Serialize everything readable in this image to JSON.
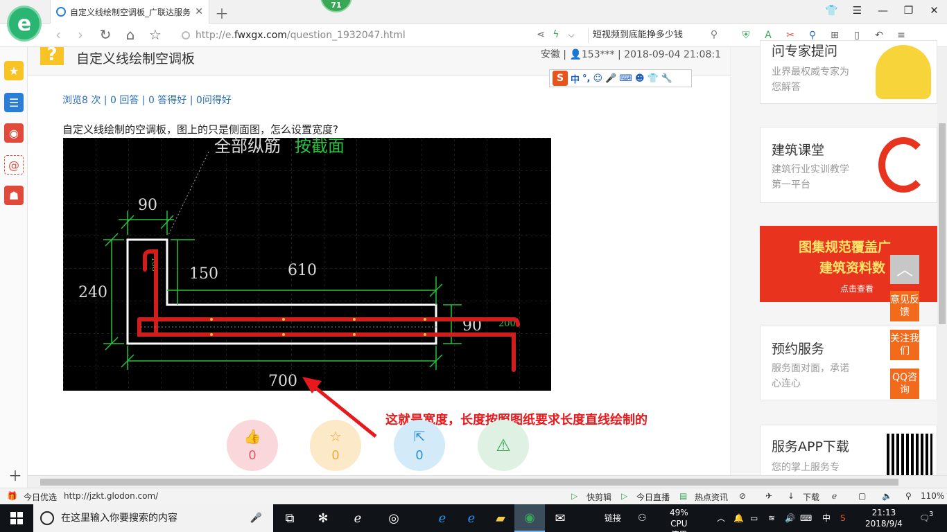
{
  "browser": {
    "tab_title": "自定义线绘制空调板_广联达服务",
    "badge_count": "71",
    "url_proto": "http://e.",
    "url_host": "fwxgx.com",
    "url_path": "/question_1932047.html",
    "search_text": "短视频到底能挣多少钱"
  },
  "question": {
    "title": "自定义线绘制空调板",
    "meta": "安徽 | 👤153*** | 2018-09-04 21:08:1",
    "stats": "浏览8 次 | 0 回答 | 0 答得好 | 0问得好",
    "body": "自定义线绘制的空调板，图上的只是侧面图，怎么设置宽度?",
    "annotation": "这就是宽度，长度按照图纸要求长度直线绘制的",
    "actions": [
      {
        "name": "like",
        "count": "0",
        "color": "#f9d7da",
        "fg": "#e05a6a"
      },
      {
        "name": "favorite",
        "count": "0",
        "color": "#fbe9c7",
        "fg": "#f2a93b"
      },
      {
        "name": "share",
        "count": "0",
        "color": "#d3eaf8",
        "fg": "#2f8fd6"
      },
      {
        "name": "report",
        "count": "",
        "color": "#dff1e2",
        "fg": "#3aa757"
      }
    ]
  },
  "ime": {
    "logo": "S",
    "mode": "中",
    "punct": "°,"
  },
  "cad": {
    "label_top": "全部纵筋",
    "label_top_green": "按截面",
    "dims": {
      "d90a": "90",
      "d240": "240",
      "d150": "150",
      "d610": "610",
      "d90b": "90",
      "d200": "200",
      "d700": "700",
      "d100": "100"
    }
  },
  "right": {
    "card1": {
      "title": "问专家提问",
      "desc": "业界最权威专家为您解答"
    },
    "card2": {
      "title": "建筑课堂",
      "desc": "建筑行业实训教学第一平台"
    },
    "banner": {
      "line1": "图集规范覆盖广",
      "line2": "建筑资料数",
      "line3": "点击查看"
    },
    "card3": {
      "title": "预约服务",
      "desc": "服务面对面，承诺心连心"
    },
    "card4": {
      "title": "服务APP下载",
      "desc": "您的掌上服务专"
    },
    "float": {
      "feedback": "意见反馈",
      "follow": "关注我们",
      "qq": "QQ咨询"
    }
  },
  "statusbar": {
    "left_label": "今日优选",
    "left_url": "http://jzkt.glodon.com/",
    "quick_cut": "快剪辑",
    "live": "今日直播",
    "news": "热点资讯",
    "download": "下载",
    "zoom": "110%"
  },
  "taskbar": {
    "search_placeholder": "在这里输入你要搜索的内容",
    "link": "链接",
    "cpu_pct": "49%",
    "cpu_label": "CPU使用",
    "ime": "中",
    "time": "21:13",
    "date": "2018/9/4",
    "notif": "3"
  }
}
